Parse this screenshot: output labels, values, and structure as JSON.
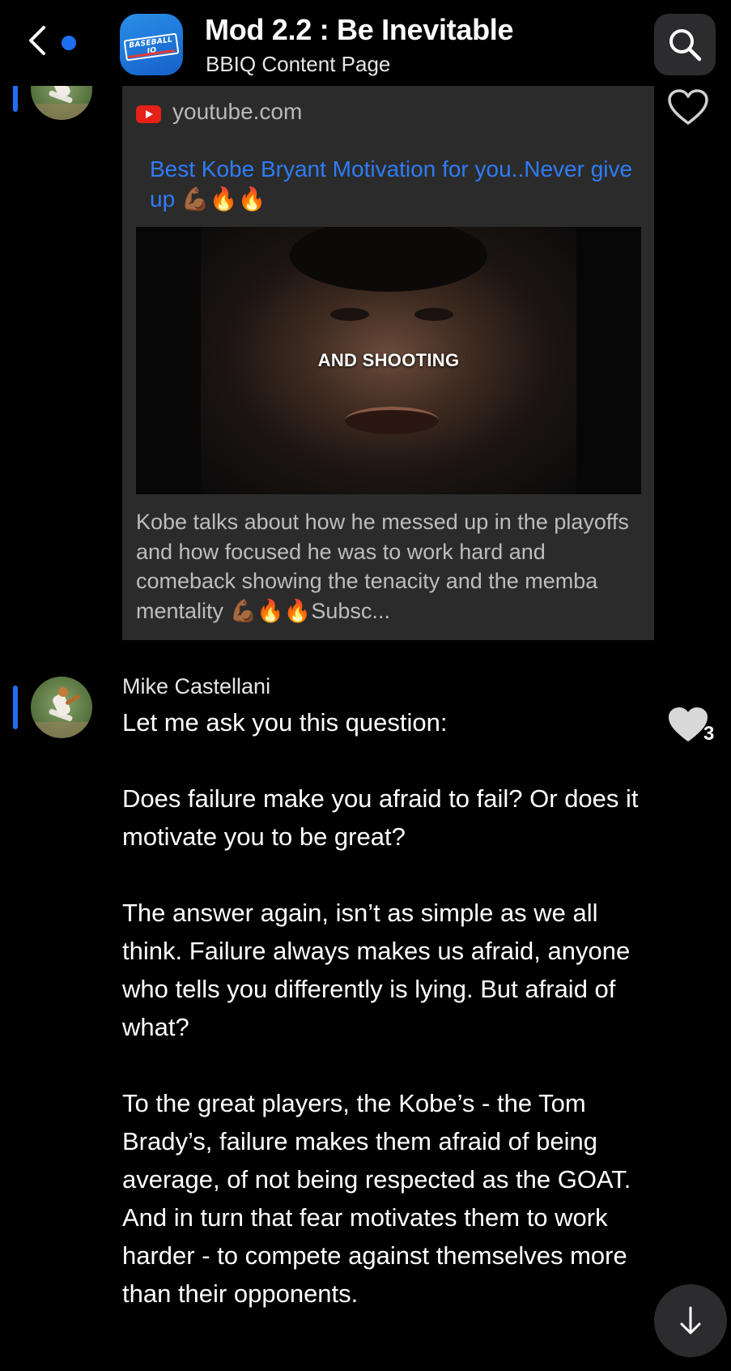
{
  "header": {
    "title": "Mod 2.2 : Be Inevitable",
    "subtitle": "BBIQ Content Page",
    "logo_text": "BASEBALL IQ"
  },
  "link_preview": {
    "domain": "youtube.com",
    "title": "Best Kobe Bryant Motivation for you..Never give up 💪🏾🔥🔥",
    "video_caption": "AND SHOOTING",
    "description": "Kobe talks about how he messed up in the playoffs and how focused he was to work hard and comeback showing the tenacity and the memba mentality 💪🏾🔥🔥Subsc..."
  },
  "post": {
    "author": "Mike Castellani",
    "likes": "3",
    "paragraphs": [
      "Let me ask you this question:",
      "Does failure make you afraid to fail? Or does it motivate you to be great?",
      "The answer again, isn’t as simple as we all think. Failure always makes us afraid, anyone who tells you differently is lying. But afraid of what?",
      "To the great players, the Kobe’s - the Tom Brady’s, failure makes them afraid of being average, of not being respected as the GOAT. And in turn that fear motivates them to work harder - to compete against themselves more than their opponents."
    ]
  },
  "colors": {
    "accent": "#1e6ff0",
    "link": "#2f7cf5",
    "card_bg": "#2b2b2b",
    "button_bg": "#2c2c2e"
  },
  "icons": {
    "back": "chevron-left-icon",
    "search": "search-icon",
    "like": "heart-icon",
    "scroll": "arrow-down-icon",
    "youtube": "youtube-icon"
  }
}
